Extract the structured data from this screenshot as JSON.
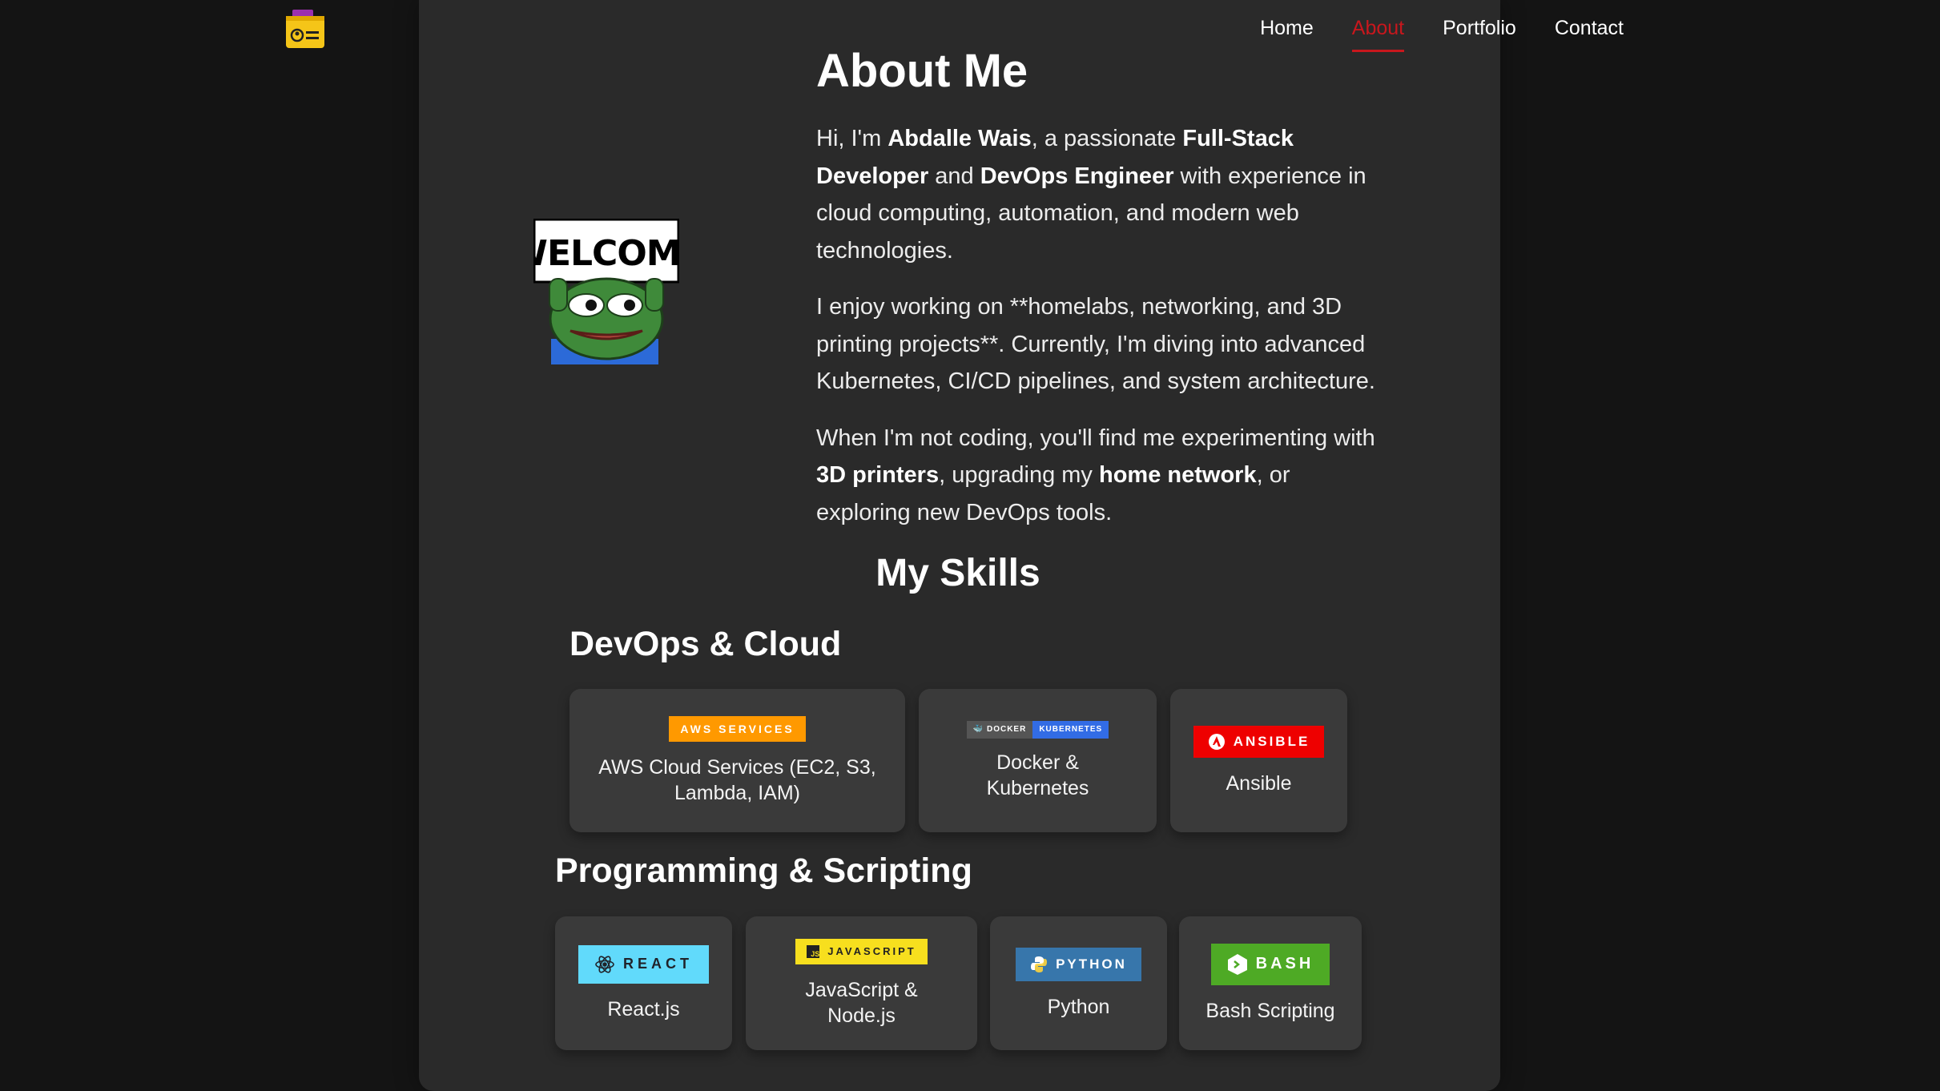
{
  "nav": {
    "items": [
      {
        "label": "Home",
        "active": false
      },
      {
        "label": "About",
        "active": true
      },
      {
        "label": "Portfolio",
        "active": false
      },
      {
        "label": "Contact",
        "active": false
      }
    ]
  },
  "about": {
    "title": "About Me",
    "p1": {
      "t1": "Hi, I'm ",
      "name": "Abdalle Wais",
      "t2": ", a passionate ",
      "role1": "Full-Stack Developer",
      "t3": " and ",
      "role2": "DevOps Engineer",
      "t4": " with experience in cloud computing, automation, and modern web technologies."
    },
    "p2": "I enjoy working on **homelabs, networking, and 3D printing projects**. Currently, I'm diving into advanced Kubernetes, CI/CD pipelines, and system architecture.",
    "p3": {
      "t1": "When I'm not coding, you'll find me experimenting with ",
      "b1": "3D printers",
      "t2": ", upgrading my ",
      "b2": "home network",
      "t3": ", or exploring new DevOps tools."
    },
    "image_text": "WELCOME"
  },
  "skills": {
    "title": "My Skills",
    "devops": {
      "title": "DevOps & Cloud",
      "cards": [
        {
          "badge": "AWS SERVICES",
          "label": "AWS Cloud Services (EC2, S3, Lambda, IAM)"
        },
        {
          "badge_left": "DOCKER",
          "badge_right": "KUBERNETES",
          "label": "Docker & Kubernetes"
        },
        {
          "badge": "ANSIBLE",
          "label": "Ansible"
        }
      ]
    },
    "programming": {
      "title": "Programming & Scripting",
      "cards": [
        {
          "badge": "REACT",
          "label": "React.js"
        },
        {
          "badge": "JAVASCRIPT",
          "label": "JavaScript & Node.js"
        },
        {
          "badge": "PYTHON",
          "label": "Python"
        },
        {
          "badge": "BASH",
          "label": "Bash Scripting"
        }
      ]
    }
  },
  "colors": {
    "background": "#141414",
    "panel": "#2a2a2a",
    "card": "#3a3a3a",
    "accent": "#c8171d",
    "aws": "#ff9900",
    "ansible": "#ee0000",
    "react": "#61dafb",
    "javascript": "#f7df1e",
    "python": "#3776ab",
    "bash": "#4eaa25",
    "kubernetes": "#326ce5"
  },
  "icons": {
    "logo": "folder-id-icon",
    "react": "atom-icon",
    "javascript": "js-icon",
    "python": "python-icon",
    "bash": "terminal-icon",
    "ansible": "ansible-icon",
    "docker": "whale-icon"
  }
}
